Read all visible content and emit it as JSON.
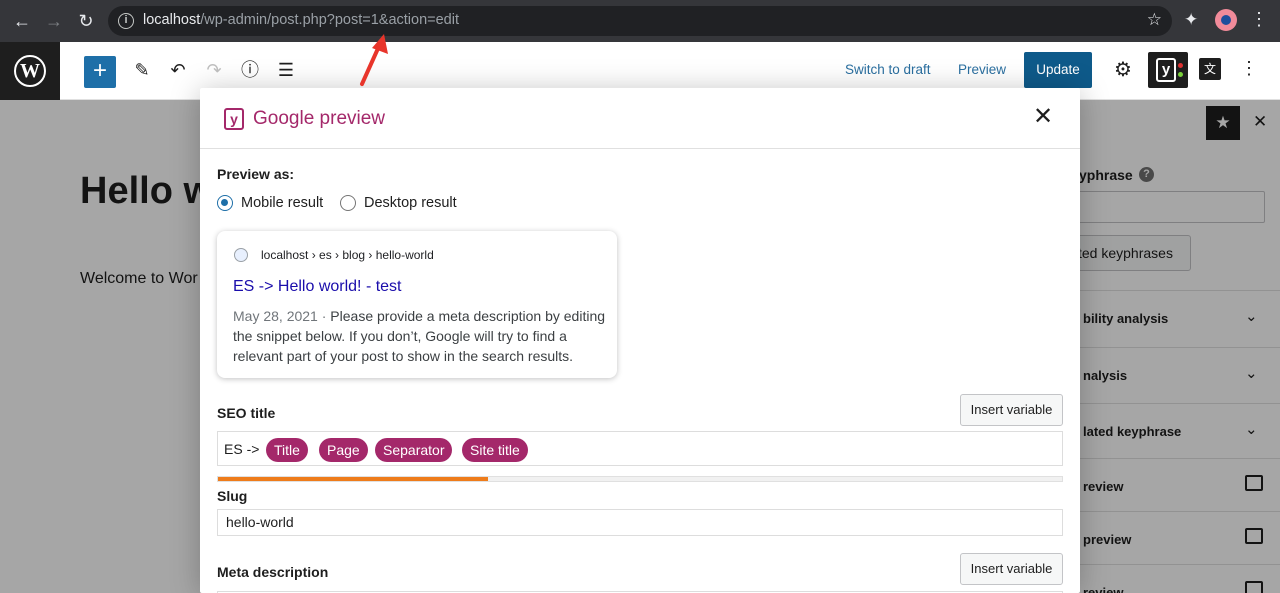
{
  "browser": {
    "url_host": "localhost",
    "url_path": "/wp-admin/post.php?post=1&action=edit"
  },
  "toolbar": {
    "switch_to_draft": "Switch to draft",
    "preview": "Preview",
    "update": "Update"
  },
  "editor": {
    "title": "Hello w",
    "body": "Welcome to Wor"
  },
  "sidebar": {
    "keyphrase_label": "yphrase",
    "related_button": "ted keyphrases",
    "rows": [
      {
        "label": "bility analysis",
        "icon": "chevron-down-icon"
      },
      {
        "label": "nalysis",
        "icon": "chevron-down-icon"
      },
      {
        "label": "lated keyphrase",
        "icon": "chevron-down-icon"
      },
      {
        "label": "review",
        "icon": "edit-icon"
      },
      {
        "label": "preview",
        "icon": "edit-icon"
      },
      {
        "label": "review",
        "icon": "edit-icon"
      }
    ]
  },
  "modal": {
    "title": "Google preview",
    "preview_as_label": "Preview as:",
    "mobile_label": "Mobile result",
    "desktop_label": "Desktop result",
    "mobile_checked": true,
    "snippet": {
      "breadcrumb": "localhost › es › blog › hello-world",
      "title": "ES -> Hello world! - test",
      "date": "May 28, 2021",
      "separator": " · ",
      "description": "Please provide a meta description by editing the snippet below. If you don’t, Google will try to find a relevant part of your post to show in the search results."
    },
    "seo_title_label": "SEO title",
    "insert_variable": "Insert variable",
    "seo_prefix": "ES ->",
    "seo_pills": [
      "Title",
      "Page",
      "Separator",
      "Site title"
    ],
    "seo_progress": 0.32,
    "slug_label": "Slug",
    "slug_value": "hello-world",
    "meta_label": "Meta description",
    "insert_variable_meta": "Insert variable"
  },
  "colors": {
    "yoast_purple": "#a4286a",
    "wp_blue": "#1e6fa8",
    "progress_orange": "#ee7c1b",
    "annotation_arrow": "#e8352b"
  }
}
